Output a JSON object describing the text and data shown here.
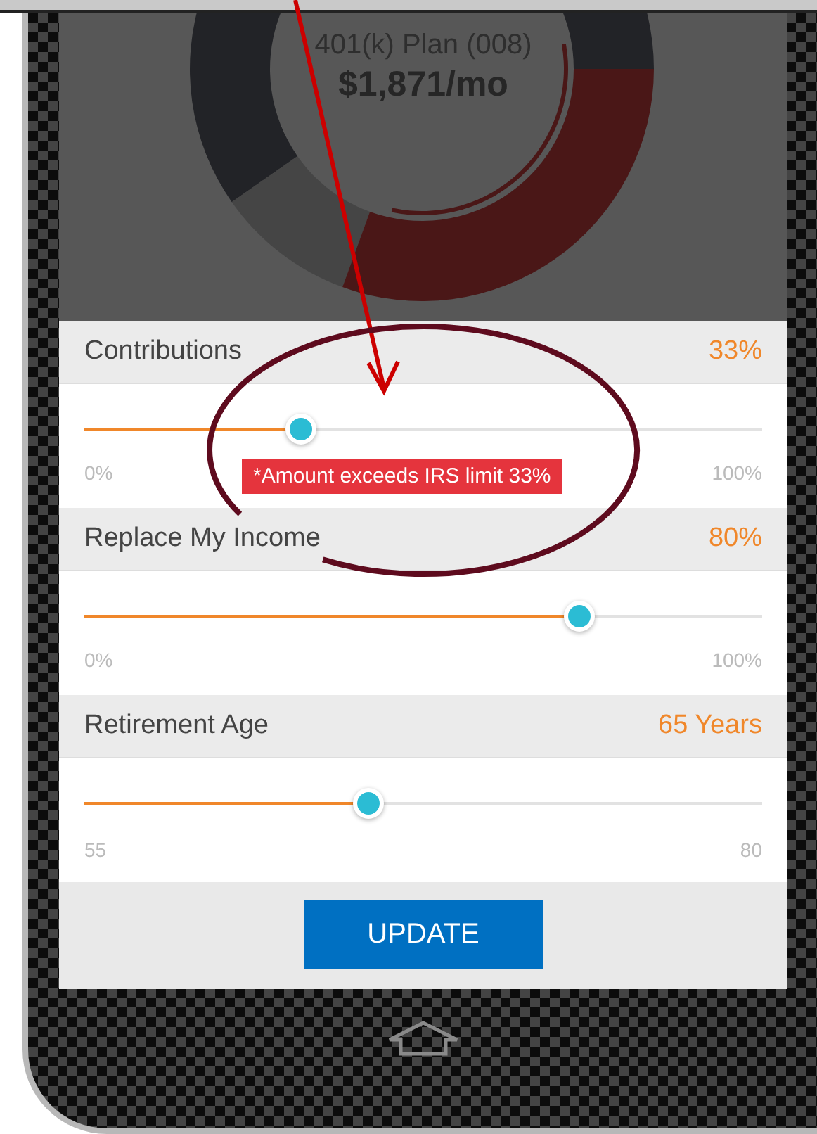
{
  "plan": {
    "title": "401(k) Plan (008)",
    "amount": "$1,871/mo"
  },
  "sliders": [
    {
      "label": "Contributions",
      "value": "33%",
      "level": 0.32,
      "min": "0%",
      "max": "100%",
      "error": "*Amount exceeds IRS limit 33%"
    },
    {
      "label": "Replace My Income",
      "value": "80%",
      "level": 0.73,
      "min": "0%",
      "max": "100%"
    },
    {
      "label": "Retirement Age",
      "value": "65 Years",
      "level": 0.42,
      "min": "55",
      "max": "80"
    }
  ],
  "button": "UPDATE",
  "annotations": [
    {
      "kind": "arrow"
    },
    {
      "kind": "ellipse"
    }
  ]
}
